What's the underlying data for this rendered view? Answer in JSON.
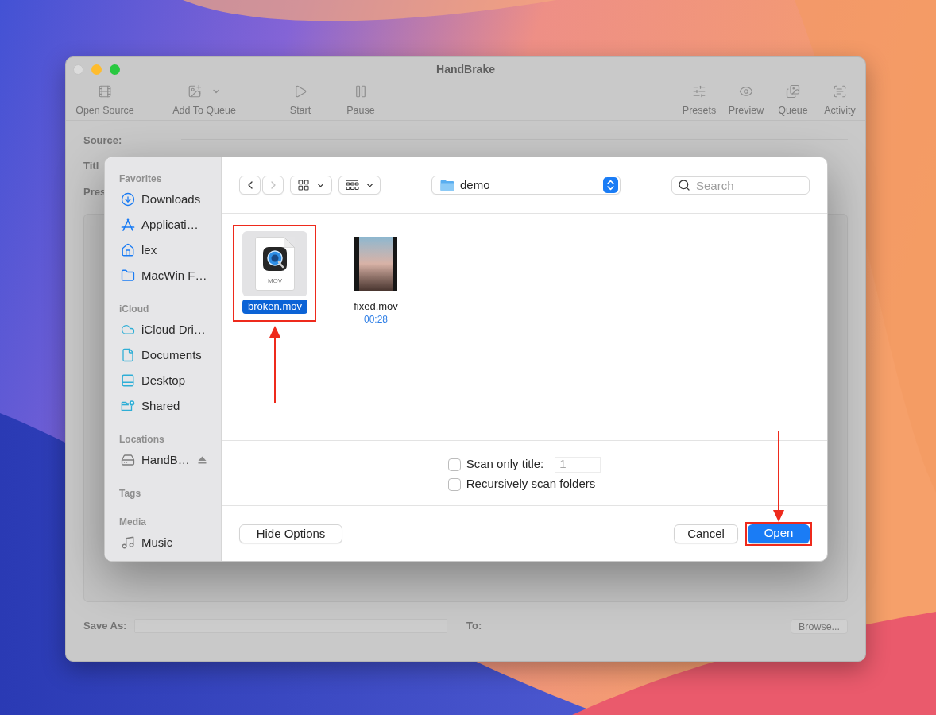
{
  "window": {
    "title": "HandBrake",
    "controls": [
      {
        "kind": "close",
        "disabled": true
      },
      {
        "kind": "minimize",
        "disabled": false
      },
      {
        "kind": "zoom",
        "disabled": false
      }
    ]
  },
  "toolbar": {
    "left": [
      {
        "kind": "film",
        "label": "Open Source",
        "menu": false
      },
      {
        "kind": "image-add",
        "label": "Add To Queue",
        "menu": true
      },
      {
        "kind": "play",
        "label": "Start",
        "menu": false
      },
      {
        "kind": "pause",
        "label": "Pause",
        "menu": false
      }
    ],
    "right": [
      {
        "kind": "sliders",
        "label": "Presets",
        "menu": false
      },
      {
        "kind": "eye",
        "label": "Preview",
        "menu": false
      },
      {
        "kind": "tray",
        "label": "Queue",
        "menu": false
      },
      {
        "kind": "scan",
        "label": "Activity",
        "menu": false
      }
    ]
  },
  "main": {
    "source_label": "Source:",
    "row_labels": [
      "Titl",
      "Pres"
    ],
    "save_as_label": "Save As:",
    "to_label": "To:",
    "browse_button": "Browse..."
  },
  "dialog": {
    "sidebar": [
      {
        "heading": "Favorites",
        "items": [
          {
            "kind": "downloads",
            "label": "Downloads"
          },
          {
            "kind": "applications",
            "label": "Applicati…"
          },
          {
            "kind": "home",
            "label": "lex"
          },
          {
            "kind": "folder",
            "label": "MacWin F…"
          }
        ]
      },
      {
        "heading": "iCloud",
        "items": [
          {
            "kind": "cloud",
            "label": "iCloud Dri…"
          },
          {
            "kind": "document",
            "label": "Documents"
          },
          {
            "kind": "desktop",
            "label": "Desktop"
          },
          {
            "kind": "shared",
            "label": "Shared"
          }
        ]
      },
      {
        "heading": "Locations",
        "items": [
          {
            "kind": "drive",
            "label": "HandB…"
          }
        ]
      },
      {
        "heading": "Tags"
      },
      {
        "heading": "Media",
        "items": [
          {
            "kind": "music",
            "label": "Music"
          }
        ]
      }
    ],
    "nav": [
      {
        "kind": "back",
        "disabled": false
      },
      {
        "kind": "forward",
        "disabled": true
      }
    ],
    "location": "demo",
    "search_placeholder": "Search",
    "files": [
      {
        "kind": "document",
        "type_label": "MOV",
        "name": "broken.mov",
        "selected": true,
        "highlighted": true
      },
      {
        "kind": "video",
        "name": "fixed.mov",
        "duration": "00:28",
        "selected": false,
        "highlighted": false
      }
    ],
    "options": [
      {
        "label": "Scan only title:",
        "checked": false,
        "field": {
          "value": "1",
          "disabled": true
        }
      },
      {
        "label": "Recursively scan folders",
        "checked": false
      }
    ],
    "hide_options_button": "Hide Options",
    "cancel_button": "Cancel",
    "open_button": {
      "label": "Open",
      "highlighted": true
    }
  }
}
